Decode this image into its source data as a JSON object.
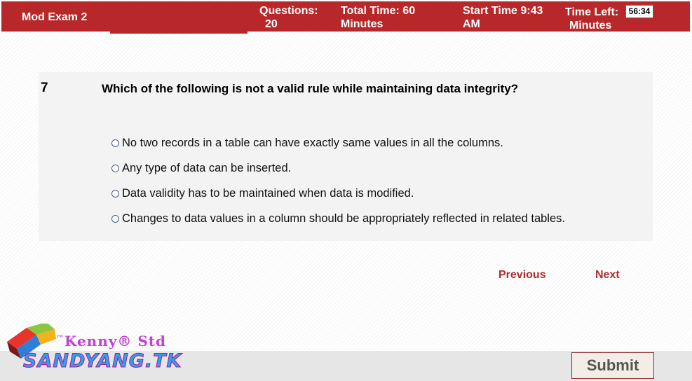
{
  "header": {
    "exam_title": "Mod Exam 2",
    "questions_label": "Questions:",
    "questions_value": "20",
    "total_time_label": "Total Time:  60",
    "total_time_unit": "Minutes",
    "start_time_label": "Start Time  9:43",
    "start_time_ampm": "AM",
    "time_left_label": "Time Left:",
    "time_left_unit": "Minutes",
    "timer_value": "56:34"
  },
  "question": {
    "number": "7",
    "text": "Which of the following is not a valid rule while maintaining data integrity?",
    "options": [
      "No two records in a table can have exactly same values in all the columns.",
      "Any type of data can be inserted.",
      "Data validity has to be maintained when data is modified.",
      "Changes to data values in a column should be appropriately reflected in related tables."
    ]
  },
  "navigation": {
    "previous_label": "Previous",
    "next_label": "Next",
    "submit_label": "Submit"
  },
  "branding": {
    "tm": "™",
    "tagline": "Kenny® Std",
    "site": "SANDYANG.TK"
  },
  "colors": {
    "header_bg": "#b8282a",
    "nav_link": "#b02a2a"
  }
}
